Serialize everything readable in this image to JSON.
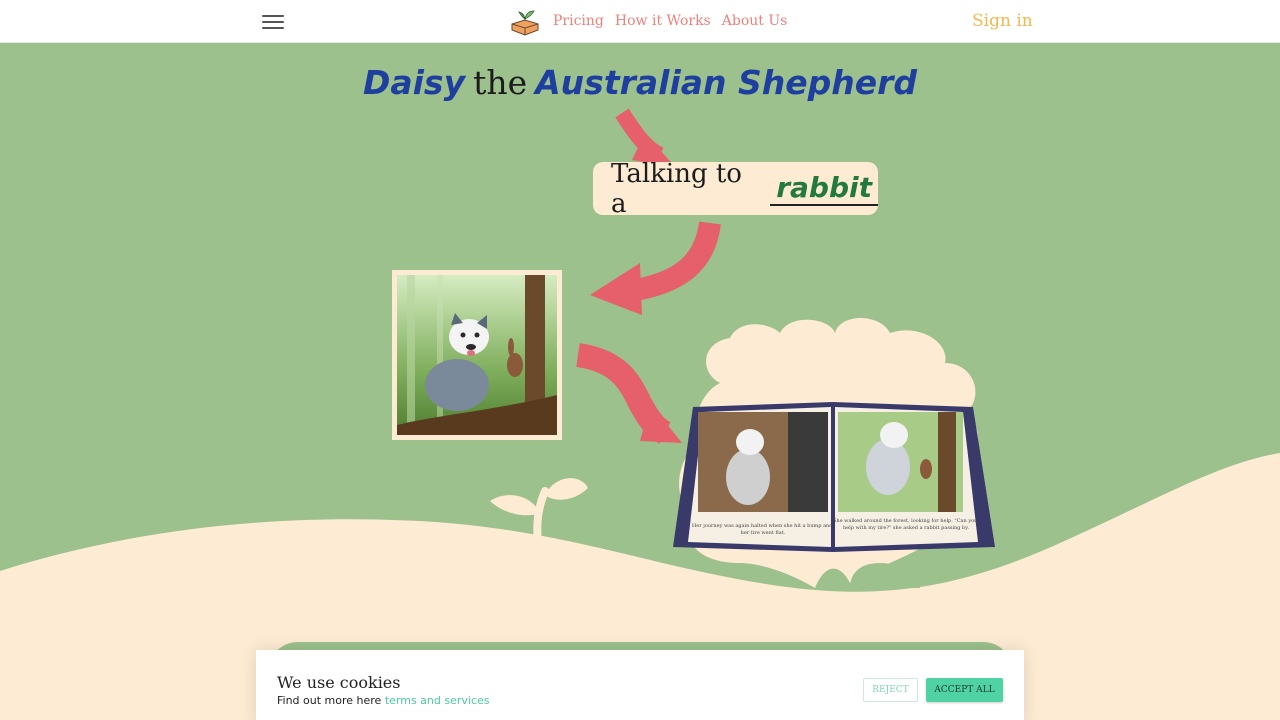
{
  "nav": {
    "links": [
      "Pricing",
      "How it Works",
      "About Us"
    ],
    "signin": "Sign in",
    "menu_icon": "hamburger-icon",
    "logo_icon": "book-sprout-logo"
  },
  "hero": {
    "name_first": "Daisy",
    "name_the": "the",
    "name_breed": "Australian Shepherd",
    "talk_prefix": "Talking to a",
    "talk_word": "rabbit",
    "book_left_caption": "Her journey was again halted when she hit a bump and her tire went flat.",
    "book_right_caption": "She walked around the forest, looking for help. \"Can you help with my tire?\" she asked a rabbit passing by."
  },
  "cookie": {
    "title": "We use cookies",
    "text": "Find out more here",
    "link": "terms and services",
    "reject": "REJECT",
    "accept": "ACCEPT ALL"
  },
  "colors": {
    "hero_green": "#9cc18c",
    "cream": "#fdebd3",
    "arrow": "#e5606a",
    "nav_link": "#f0807a",
    "signin": "#f5b84c",
    "accept": "#4fd3a4"
  }
}
